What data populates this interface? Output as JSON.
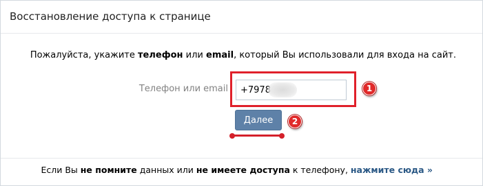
{
  "header": {
    "title": "Восстановление доступа к странице"
  },
  "instruction": {
    "prefix": "Пожалуйста, укажите ",
    "bold1": "телефон",
    "middle": " или ",
    "bold2": "email",
    "suffix": ", который Вы использовали для входа на сайт."
  },
  "form": {
    "field_label": "Телефон или email",
    "phone_value": "+7978",
    "submit_label": "Далее"
  },
  "annotations": {
    "badge1": "1",
    "badge2": "2",
    "highlight_color": "#e0202a"
  },
  "footer": {
    "prefix": "Если Вы ",
    "bold1": "не помните",
    "middle": " данных или ",
    "bold2": "не имеете доступа",
    "suffix": " к телефону, ",
    "link": "нажмите сюда »"
  },
  "colors": {
    "button_bg": "#5e81a8",
    "link": "#2a5885",
    "label": "#828282"
  }
}
